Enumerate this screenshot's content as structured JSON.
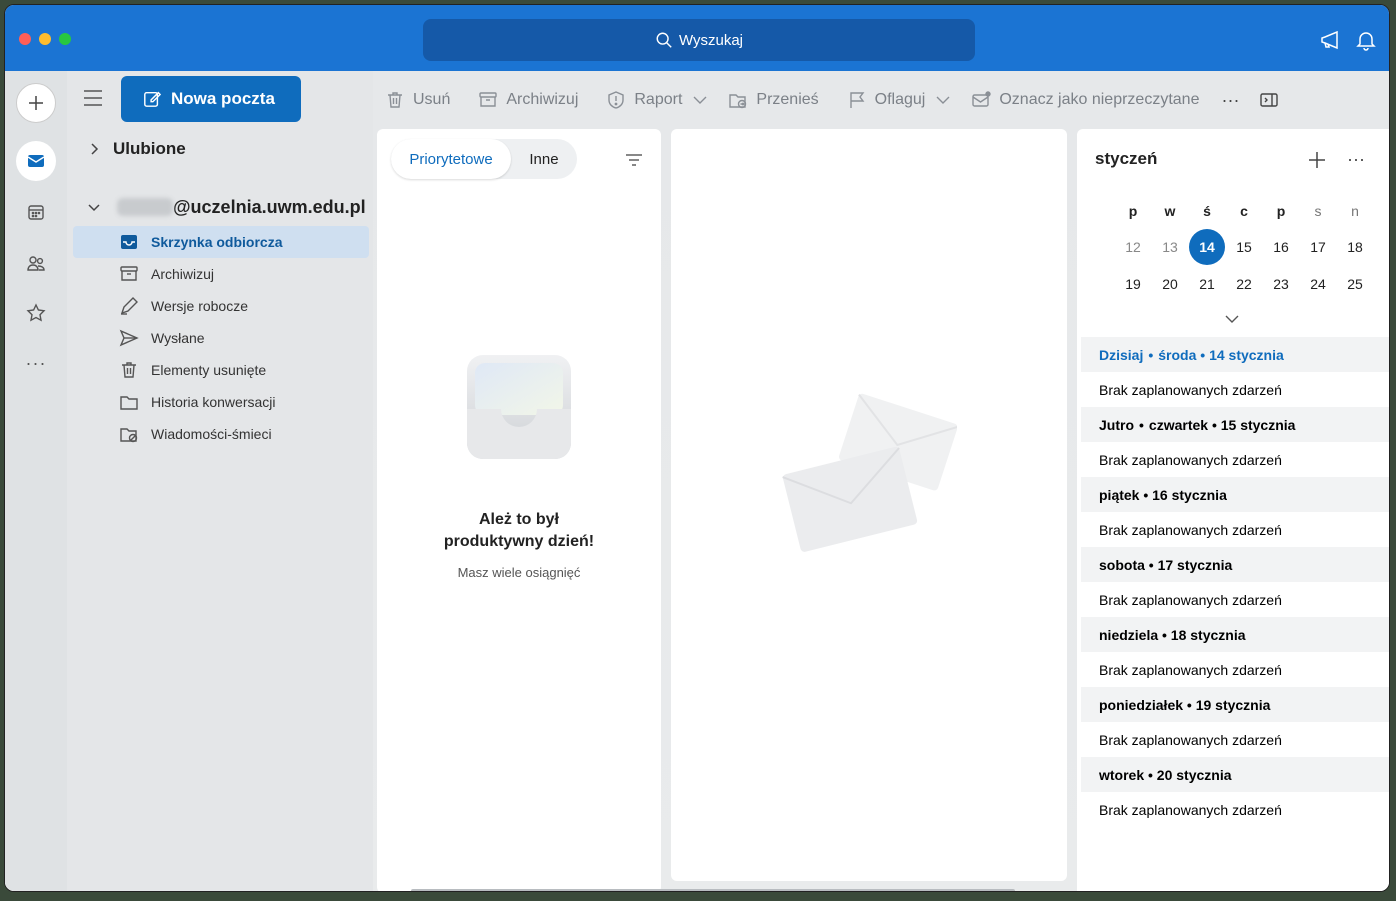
{
  "window": {
    "search_label": "Wyszukaj",
    "colors": {
      "titlebar": "#1b74d3",
      "accent": "#0f6cbd",
      "today": "#0f6cbd"
    }
  },
  "rail": {
    "items": [
      "new-icon",
      "mail-icon",
      "calendar-icon",
      "people-icon",
      "favorites-icon",
      "more-icon"
    ]
  },
  "toolbar": {
    "new_mail_label": "Nowa poczta",
    "actions": [
      {
        "label": "Usuń",
        "icon": "trash-icon"
      },
      {
        "label": "Archiwizuj",
        "icon": "archive-icon"
      },
      {
        "label": "Raport",
        "icon": "shield-icon"
      },
      {
        "label": "Przenieś",
        "icon": "move-icon"
      },
      {
        "label": "Oflaguj",
        "icon": "flag-icon"
      },
      {
        "label": "Oznacz jako nieprzeczytane",
        "icon": "mark-unread-icon"
      }
    ]
  },
  "sidebar": {
    "favorites_label": "Ulubione",
    "account_label": "@uczelnia.uwm.edu.pl",
    "folders": [
      {
        "label": "Skrzynka odbiorcza",
        "icon": "inbox-icon",
        "active": true
      },
      {
        "label": "Archiwizuj",
        "icon": "archive-icon"
      },
      {
        "label": "Wersje robocze",
        "icon": "draft-icon"
      },
      {
        "label": "Wysłane",
        "icon": "send-icon"
      },
      {
        "label": "Elementy usunięte",
        "icon": "trash-icon"
      },
      {
        "label": "Historia konwersacji",
        "icon": "folder-icon"
      },
      {
        "label": "Wiadomości-śmieci",
        "icon": "junk-icon"
      }
    ]
  },
  "message_list": {
    "tabs": [
      "Priorytetowe",
      "Inne"
    ],
    "empty_title_1": "Ależ to był",
    "empty_title_2": "produktywny dzień!",
    "empty_subtitle": "Masz wiele osiągnięć"
  },
  "calendar": {
    "month": "styczeń",
    "weekdays": [
      "p",
      "w",
      "ś",
      "c",
      "p",
      "s",
      "n"
    ],
    "week1": [
      "12",
      "13",
      "14",
      "15",
      "16",
      "17",
      "18"
    ],
    "week2": [
      "19",
      "20",
      "21",
      "22",
      "23",
      "24",
      "25"
    ],
    "today": "14",
    "agenda": [
      {
        "header_prefix": "Dzisiaj",
        "header": "środa • 14 stycznia",
        "empty": "Brak zaplanowanych zdarzeń"
      },
      {
        "header_prefix": "Jutro",
        "header": "czwartek • 15 stycznia",
        "empty": "Brak zaplanowanych zdarzeń"
      },
      {
        "header": "piątek • 16 stycznia",
        "empty": "Brak zaplanowanych zdarzeń"
      },
      {
        "header": "sobota • 17 stycznia",
        "empty": "Brak zaplanowanych zdarzeń"
      },
      {
        "header": "niedziela • 18 stycznia",
        "empty": "Brak zaplanowanych zdarzeń"
      },
      {
        "header": "poniedziałek • 19 stycznia",
        "empty": "Brak zaplanowanych zdarzeń"
      },
      {
        "header": "wtorek • 20 stycznia",
        "empty": "Brak zaplanowanych zdarzeń"
      }
    ]
  }
}
